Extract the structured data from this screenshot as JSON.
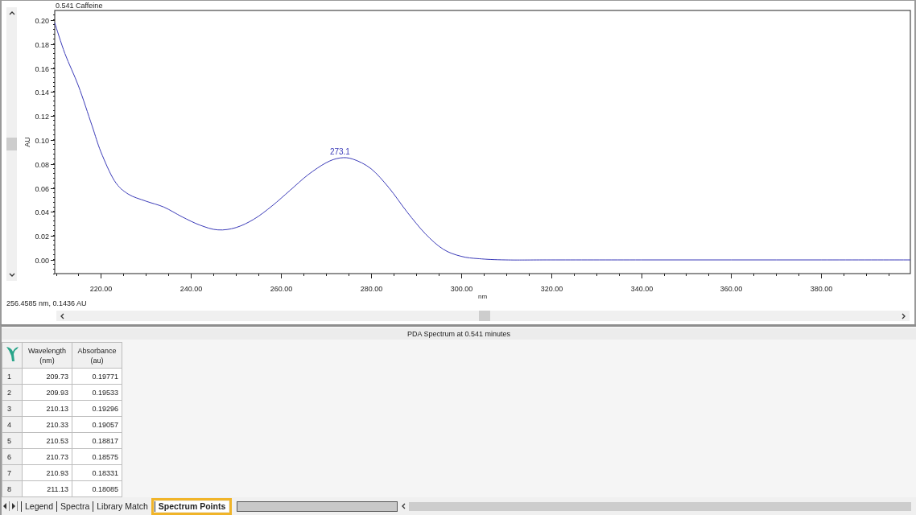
{
  "chart": {
    "cursor_readout": "256.4585 nm, 0.1436 AU",
    "chart_data": {
      "type": "line",
      "title": "0.541 Caffeine",
      "xlabel": "nm",
      "ylabel": "AU",
      "x": [
        209.73,
        212,
        215,
        218,
        220,
        223,
        226,
        230,
        234,
        238,
        242,
        246,
        250,
        254,
        258,
        262,
        266,
        270,
        273.1,
        276,
        280,
        284,
        288,
        292,
        296,
        300,
        304,
        310,
        320,
        340,
        360,
        380,
        399.8
      ],
      "series": [
        {
          "color": "#3a3ab8",
          "values": [
            0.1977,
            0.172,
            0.145,
            0.112,
            0.09,
            0.066,
            0.055,
            0.049,
            0.044,
            0.036,
            0.029,
            0.025,
            0.027,
            0.034,
            0.045,
            0.058,
            0.071,
            0.081,
            0.085,
            0.084,
            0.076,
            0.06,
            0.04,
            0.022,
            0.009,
            0.003,
            0.001,
            0,
            0,
            0,
            0,
            0,
            0
          ]
        }
      ],
      "xlim": [
        209.73,
        399.8
      ],
      "ylim": [
        -0.0114,
        0.208
      ],
      "xticks": [
        {
          "value": 220,
          "label": "220.00"
        },
        {
          "value": 240,
          "label": "240.00"
        },
        {
          "value": 260,
          "label": "260.00"
        },
        {
          "value": 280,
          "label": "280.00"
        },
        {
          "value": 300,
          "label": "300.00"
        },
        {
          "value": 320,
          "label": "320.00"
        },
        {
          "value": 340,
          "label": "340.00"
        },
        {
          "value": 360,
          "label": "360.00"
        },
        {
          "value": 380,
          "label": "380.00"
        }
      ],
      "yticks": [
        {
          "value": 0,
          "label": "0.00"
        },
        {
          "value": 0.02,
          "label": "0.02"
        },
        {
          "value": 0.04,
          "label": "0.04"
        },
        {
          "value": 0.06,
          "label": "0.06"
        },
        {
          "value": 0.08,
          "label": "0.08"
        },
        {
          "value": 0.1,
          "label": "0.10"
        },
        {
          "value": 0.12,
          "label": "0.12"
        },
        {
          "value": 0.14,
          "label": "0.14"
        },
        {
          "value": 0.16,
          "label": "0.16"
        },
        {
          "value": 0.18,
          "label": "0.18"
        },
        {
          "value": 0.2,
          "label": "0.20"
        }
      ],
      "annotations": [
        {
          "x": 273.1,
          "y": 0.085,
          "text": "273.1"
        }
      ]
    }
  },
  "spectrum_table": {
    "title": "PDA Spectrum at 0.541 minutes",
    "columns": [
      "Wavelength (nm)",
      "Absorbance (au)"
    ],
    "rows": [
      {
        "index": "1",
        "wavelength": "209.73",
        "absorbance": "0.19771"
      },
      {
        "index": "2",
        "wavelength": "209.93",
        "absorbance": "0.19533"
      },
      {
        "index": "3",
        "wavelength": "210.13",
        "absorbance": "0.19296"
      },
      {
        "index": "4",
        "wavelength": "210.33",
        "absorbance": "0.19057"
      },
      {
        "index": "5",
        "wavelength": "210.53",
        "absorbance": "0.18817"
      },
      {
        "index": "6",
        "wavelength": "210.73",
        "absorbance": "0.18575"
      },
      {
        "index": "7",
        "wavelength": "210.93",
        "absorbance": "0.18331"
      },
      {
        "index": "8",
        "wavelength": "211.13",
        "absorbance": "0.18085"
      }
    ]
  },
  "tabs": [
    {
      "label": "Legend",
      "selected": false
    },
    {
      "label": "Spectra",
      "selected": false
    },
    {
      "label": "Library Match",
      "selected": false
    },
    {
      "label": "Spectrum Points",
      "selected": true
    }
  ]
}
